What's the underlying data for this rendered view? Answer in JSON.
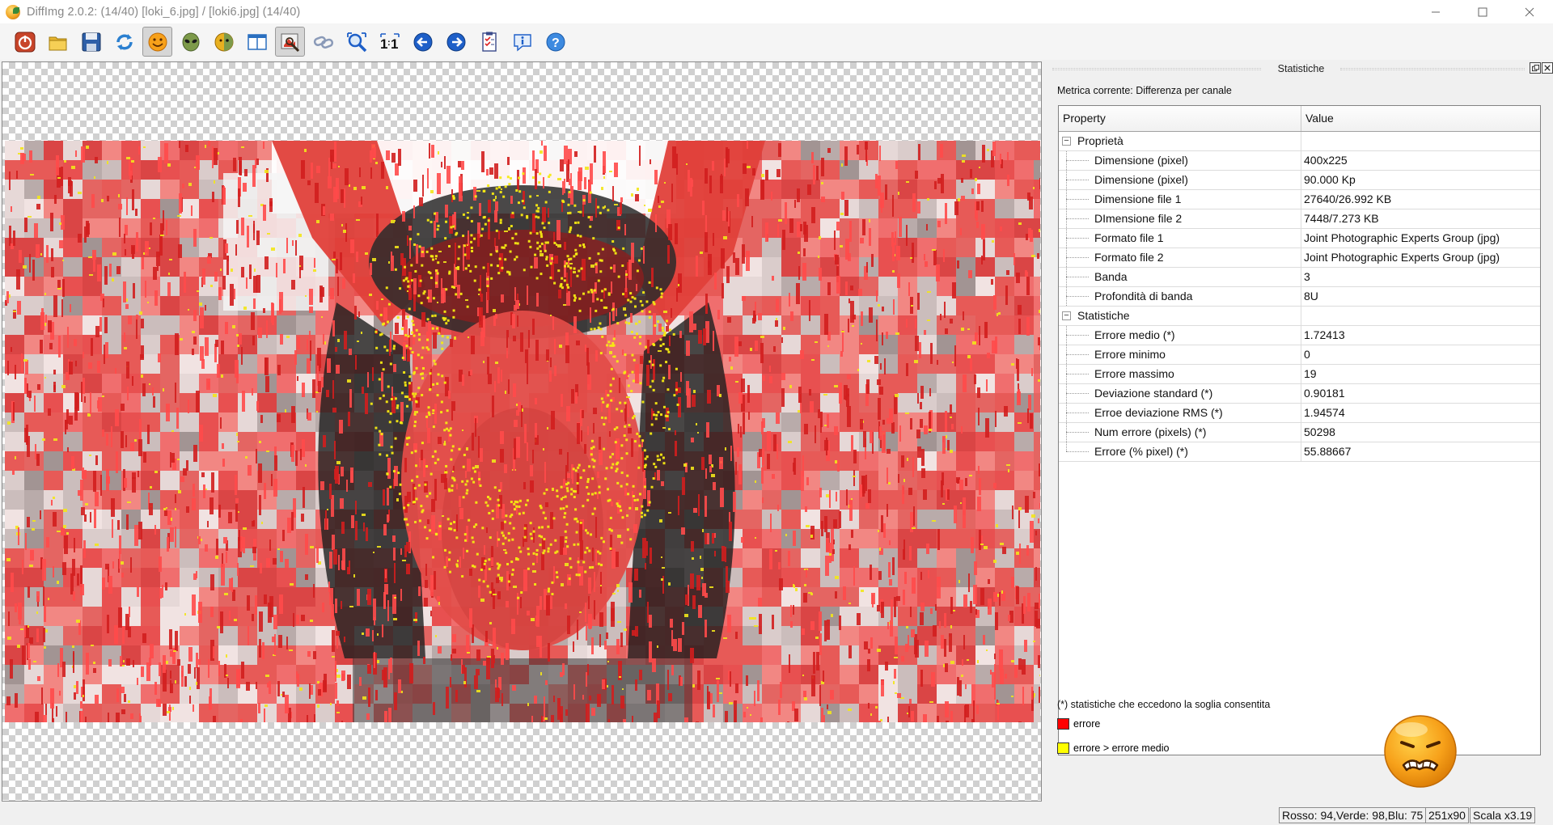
{
  "window": {
    "title": "DiffImg 2.0.2:  (14/40) [loki_6.jpg] / [loki6.jpg] (14/40)",
    "controls": [
      "minimize",
      "maximize",
      "close"
    ]
  },
  "toolbar": {
    "buttons": [
      {
        "name": "quit-icon",
        "tooltip": ""
      },
      {
        "name": "open-folder-icon"
      },
      {
        "name": "save-icon"
      },
      {
        "name": "refresh-icon"
      },
      {
        "name": "image1-smiley-icon"
      },
      {
        "name": "image2-alien-icon"
      },
      {
        "name": "difference-icon"
      },
      {
        "name": "dual-panel-icon"
      },
      {
        "name": "show-difference-mask-icon",
        "active": true
      },
      {
        "name": "link-icon"
      },
      {
        "name": "zoom-fit-icon"
      },
      {
        "name": "zoom-1to1-icon"
      },
      {
        "name": "previous-icon"
      },
      {
        "name": "next-icon"
      },
      {
        "name": "preferences-checklist-icon"
      },
      {
        "name": "info-icon"
      },
      {
        "name": "help-icon"
      }
    ]
  },
  "dock": {
    "title": "Statistiche",
    "metric_label": "Metrica corrente: Differenza per canale",
    "table": {
      "headers": [
        "Property",
        "Value"
      ],
      "groups": [
        {
          "name": "Proprietà",
          "rows": [
            {
              "property": "Dimensione (pixel)",
              "value": "400x225"
            },
            {
              "property": "Dimensione (pixel)",
              "value": "90.000 Kp"
            },
            {
              "property": "Dimensione file 1",
              "value": "27640/26.992 KB"
            },
            {
              "property": "DImensione file 2",
              "value": "7448/7.273 KB"
            },
            {
              "property": "Formato file 1",
              "value": "Joint Photographic Experts Group (jpg)"
            },
            {
              "property": "Formato file 2",
              "value": "Joint Photographic Experts Group (jpg)"
            },
            {
              "property": "Banda",
              "value": "3"
            },
            {
              "property": "Profondità di banda",
              "value": "8U"
            }
          ]
        },
        {
          "name": "Statistiche",
          "rows": [
            {
              "property": "Errore medio (*)",
              "value": "1.72413"
            },
            {
              "property": "Errore minimo",
              "value": "0"
            },
            {
              "property": "Errore massimo",
              "value": "19"
            },
            {
              "property": "Deviazione standard (*)",
              "value": "0.90181"
            },
            {
              "property": "Erroe deviazione RMS (*)",
              "value": "1.94574"
            },
            {
              "property": "Num errore (pixels) (*)",
              "value": "50298"
            },
            {
              "property": "Errore (% pixel) (*)",
              "value": "55.88667"
            }
          ]
        }
      ]
    },
    "footnote": "(*) statistiche che eccedono la soglia consentita",
    "legend": [
      {
        "label": "errore",
        "color": "#ff0000"
      },
      {
        "label": "errore > errore medio",
        "color": "#ffff00"
      }
    ],
    "status_face": "unhappy-face-icon"
  },
  "statusbar": {
    "pixel_value": "Rosso: 94,Verde: 98,Blu: 75",
    "position": "251x90",
    "scale": "Scala x3.19"
  },
  "colors": {
    "error": "#ff0000",
    "error_above_mean": "#ffff00",
    "accent_blue": "#1e5fc8"
  }
}
